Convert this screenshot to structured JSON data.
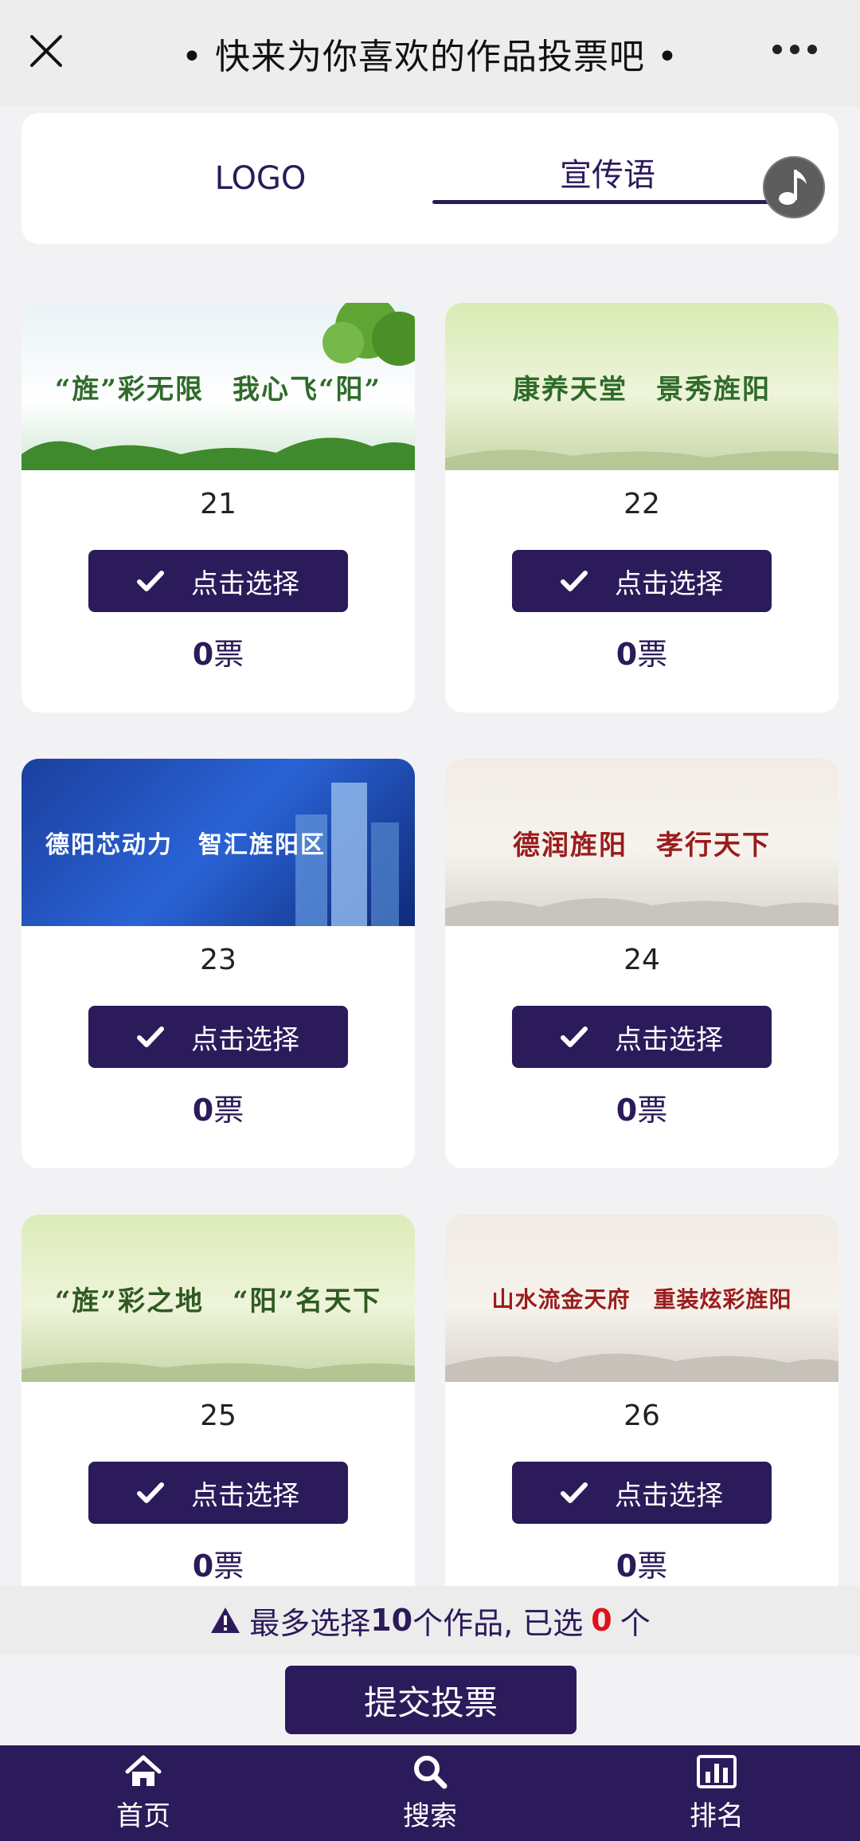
{
  "header": {
    "title": "• 快来为你喜欢的作品投票吧 •",
    "close_icon": "close-icon",
    "more_icon": "more-dots-icon"
  },
  "tabs": {
    "items": [
      {
        "label": "LOGO",
        "active": false
      },
      {
        "label": "宣传语",
        "active": true
      }
    ]
  },
  "music": {
    "icon": "music-note-icon"
  },
  "entries": [
    {
      "number": "21",
      "image_text": "“旌”彩无限　我心飞“阳”",
      "select_label": "点击选择",
      "votes": "0",
      "vote_unit": "票",
      "theme": "green"
    },
    {
      "number": "22",
      "image_text": "康养天堂　景秀旌阳",
      "select_label": "点击选择",
      "votes": "0",
      "vote_unit": "票",
      "theme": "lightgreen"
    },
    {
      "number": "23",
      "image_text": "德阳芯动力　智汇旌阳区",
      "select_label": "点击选择",
      "votes": "0",
      "vote_unit": "票",
      "theme": "blue"
    },
    {
      "number": "24",
      "image_text": "德润旌阳　孝行天下",
      "select_label": "点击选择",
      "votes": "0",
      "vote_unit": "票",
      "theme": "ink"
    },
    {
      "number": "25",
      "image_text": "“旌”彩之地　“阳”名天下",
      "select_label": "点击选择",
      "votes": "0",
      "vote_unit": "票",
      "theme": "lightgreen"
    },
    {
      "number": "26",
      "image_text": "山水流金天府　重装炫彩旌阳",
      "select_label": "点击选择",
      "votes": "0",
      "vote_unit": "票",
      "theme": "ink"
    }
  ],
  "limit_bar": {
    "prefix": "最多选择",
    "max": "10",
    "middle": "个作品, 已选",
    "selected": "0",
    "suffix": "个",
    "icon": "warning-icon"
  },
  "submit": {
    "label": "提交投票"
  },
  "bottom_nav": [
    {
      "label": "首页",
      "icon": "home-icon"
    },
    {
      "label": "搜索",
      "icon": "search-icon"
    },
    {
      "label": "排名",
      "icon": "bar-chart-icon"
    }
  ],
  "colors": {
    "primary": "#2b1b5a",
    "highlight": "#e0101a",
    "background": "#f2f2f4"
  }
}
